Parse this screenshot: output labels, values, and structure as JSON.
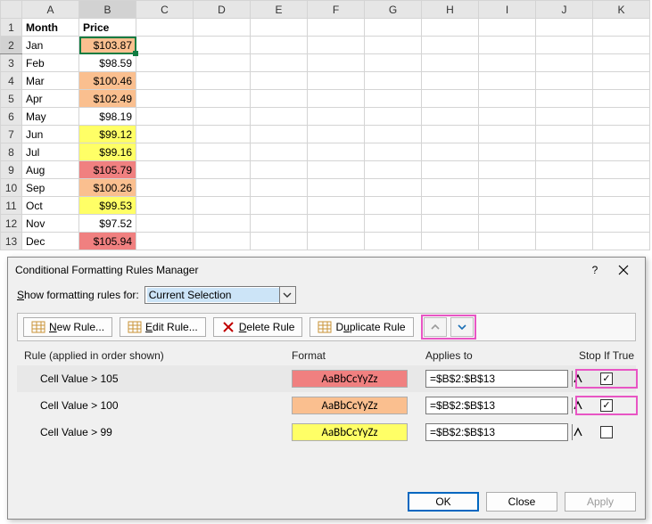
{
  "sheet": {
    "columns": [
      "A",
      "B",
      "C",
      "D",
      "E",
      "F",
      "G",
      "H",
      "I",
      "J",
      "K"
    ],
    "rowcount": 13,
    "selected_cell": "B2",
    "headers": {
      "A": "Month",
      "B": "Price"
    },
    "data": [
      {
        "row": 2,
        "month": "Jan",
        "price": "$103.87",
        "fill": "orange"
      },
      {
        "row": 3,
        "month": "Feb",
        "price": "$98.59",
        "fill": ""
      },
      {
        "row": 4,
        "month": "Mar",
        "price": "$100.46",
        "fill": "orange"
      },
      {
        "row": 5,
        "month": "Apr",
        "price": "$102.49",
        "fill": "orange"
      },
      {
        "row": 6,
        "month": "May",
        "price": "$98.19",
        "fill": ""
      },
      {
        "row": 7,
        "month": "Jun",
        "price": "$99.12",
        "fill": "yellow"
      },
      {
        "row": 8,
        "month": "Jul",
        "price": "$99.16",
        "fill": "yellow"
      },
      {
        "row": 9,
        "month": "Aug",
        "price": "$105.79",
        "fill": "red"
      },
      {
        "row": 10,
        "month": "Sep",
        "price": "$100.26",
        "fill": "orange"
      },
      {
        "row": 11,
        "month": "Oct",
        "price": "$99.53",
        "fill": "yellow"
      },
      {
        "row": 12,
        "month": "Nov",
        "price": "$97.52",
        "fill": ""
      },
      {
        "row": 13,
        "month": "Dec",
        "price": "$105.94",
        "fill": "red"
      }
    ]
  },
  "dialog": {
    "title": "Conditional Formatting Rules Manager",
    "help_symbol": "?",
    "scope_label": "Show formatting rules for:",
    "scope_value": "Current Selection",
    "buttons": {
      "new": "New Rule...",
      "edit": "Edit Rule...",
      "delete": "Delete Rule",
      "dup": "Duplicate Rule"
    },
    "mnemonic": {
      "new": "N",
      "edit": "E",
      "delete": "D",
      "dup": "D"
    },
    "headers": {
      "rule": "Rule (applied in order shown)",
      "format": "Format",
      "applies": "Applies to",
      "stop": "Stop If True"
    },
    "format_sample": "AaBbCcYyZz",
    "rules": [
      {
        "desc": "Cell Value > 105",
        "fill": "red",
        "applies": "=$B$2:$B$13",
        "stop": true,
        "selected": true
      },
      {
        "desc": "Cell Value > 100",
        "fill": "orange",
        "applies": "=$B$2:$B$13",
        "stop": true,
        "selected": false
      },
      {
        "desc": "Cell Value > 99",
        "fill": "yellow",
        "applies": "=$B$2:$B$13",
        "stop": false,
        "selected": false
      }
    ],
    "footer": {
      "ok": "OK",
      "close": "Close",
      "apply": "Apply"
    }
  },
  "colors": {
    "red": "#f08080",
    "orange": "#fabf8f",
    "yellow": "#ffff66"
  }
}
